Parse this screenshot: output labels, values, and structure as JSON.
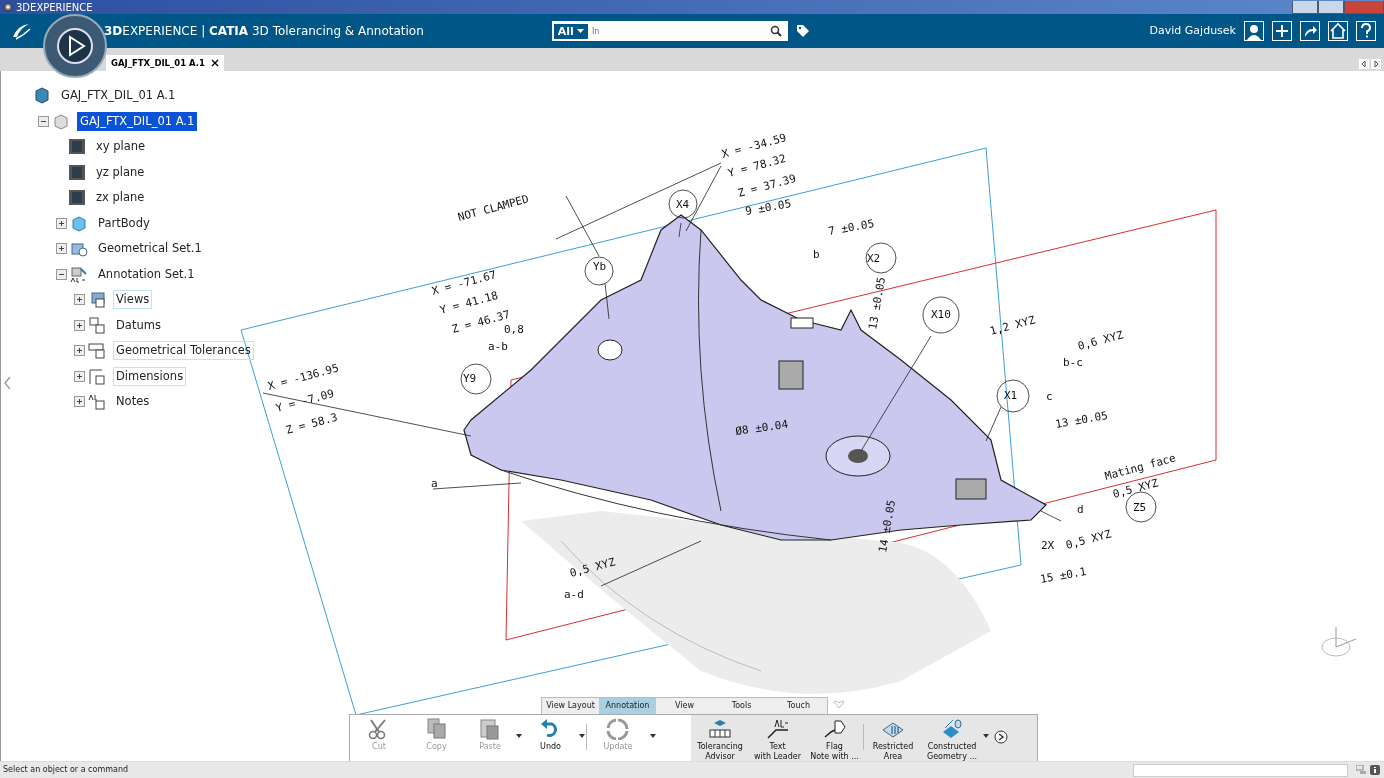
{
  "window": {
    "title": "3DEXPERIENCE"
  },
  "header": {
    "title": "**3D**EXPERIENCE | **CATIA** 3D Tolerancing & Annotation",
    "search": {
      "scope": "All",
      "placeholder": "In"
    },
    "user": "David Gajdusek"
  },
  "tabs": [
    {
      "label": "GAJ_FTX_DIL_01 A.1",
      "selected": true
    }
  ],
  "tree": [
    {
      "label": "GAJ_FTX_DIL_01 A.1",
      "kind": "product",
      "selected": false,
      "children": [
        {
          "label": "GAJ_FTX_DIL_01 A.1",
          "kind": "part",
          "selected": true,
          "expanded": true,
          "children": [
            {
              "label": "xy plane",
              "kind": "plane",
              "selected": false
            },
            {
              "label": "yz plane",
              "kind": "plane",
              "selected": false
            },
            {
              "label": "zx plane",
              "kind": "plane",
              "selected": false
            },
            {
              "label": "PartBody",
              "kind": "body",
              "selected": false,
              "expanded": false
            },
            {
              "label": "Geometrical Set.1",
              "kind": "geoset",
              "selected": false,
              "expanded": false
            },
            {
              "label": "Annotation Set.1",
              "kind": "annotation",
              "selected": false,
              "expanded": true,
              "children": [
                {
                  "label": "Views",
                  "kind": "views",
                  "selected": false,
                  "expanded": false,
                  "highlighted": true
                },
                {
                  "label": "Datums",
                  "kind": "datums",
                  "selected": false,
                  "expanded": false,
                  "highlighted": false
                },
                {
                  "label": "Geometrical Tolerances",
                  "kind": "tolerances",
                  "selected": false,
                  "expanded": false,
                  "highlighted": true
                },
                {
                  "label": "Dimensions",
                  "kind": "dimensions",
                  "selected": false,
                  "expanded": false,
                  "highlighted": true
                },
                {
                  "label": "Notes",
                  "kind": "notes",
                  "selected": false,
                  "expanded": false,
                  "highlighted": false
                }
              ]
            }
          ]
        }
      ]
    }
  ],
  "viewport": {
    "annotations": [
      "NOT CLAMPED",
      "X = -34.59",
      "Y = 78.32",
      "Z = 37.39",
      "X4",
      "9 ±0.05",
      "7 ±0.05",
      "X2",
      "b",
      "Yb",
      "X = -71.67",
      "Y = 41.18",
      "Z = 46.37",
      "0,8",
      "a-b",
      "13 ±0.05",
      "X10",
      "1,2 XYZ",
      "0,6 XYZ",
      "b-c",
      "X = -136.95",
      "Y = -7.09",
      "Z = 58.3",
      "Y9",
      "X1",
      "c",
      "13 ±0.05",
      "Ø8 ±0.04",
      "a",
      "Mating face",
      "0,5 XYZ",
      "d",
      "2X",
      "0,5 XYZ",
      "Z5",
      "14 ±0.05",
      "15 ±0.1",
      "0,5 XYZ",
      "a-d"
    ]
  },
  "action_bar": {
    "tabs": [
      {
        "label": "View Layout",
        "selected": false
      },
      {
        "label": "Annotation",
        "selected": true
      },
      {
        "label": "View",
        "selected": false
      },
      {
        "label": "Tools",
        "selected": false
      },
      {
        "label": "Touch",
        "selected": false
      }
    ],
    "commands": [
      {
        "kind": "cut",
        "label": [
          "Cut"
        ],
        "disabled": true,
        "dropdown": false
      },
      {
        "kind": "copy",
        "label": [
          "Copy"
        ],
        "disabled": true,
        "dropdown": false
      },
      {
        "kind": "paste",
        "label": [
          "Paste"
        ],
        "disabled": true,
        "dropdown": true
      },
      {
        "kind": "undo",
        "label": [
          "Undo"
        ],
        "disabled": false,
        "dropdown": true
      },
      {
        "kind": "update",
        "label": [
          "Update"
        ],
        "disabled": true,
        "dropdown": true
      },
      {
        "kind": "advisor",
        "label": [
          "Tolerancing",
          "Advisor"
        ],
        "disabled": false,
        "dropdown": false
      },
      {
        "kind": "text",
        "label": [
          "Text",
          "with Leader"
        ],
        "disabled": false,
        "dropdown": false
      },
      {
        "kind": "flag",
        "label": [
          "Flag",
          "Note with ..."
        ],
        "disabled": false,
        "dropdown": false
      },
      {
        "kind": "area",
        "label": [
          "Restricted",
          "Area"
        ],
        "disabled": false,
        "dropdown": false
      },
      {
        "kind": "geometry",
        "label": [
          "Constructed",
          "Geometry ..."
        ],
        "disabled": false,
        "dropdown": true
      }
    ]
  },
  "status_bar": {
    "message": "Select an object or a command"
  }
}
